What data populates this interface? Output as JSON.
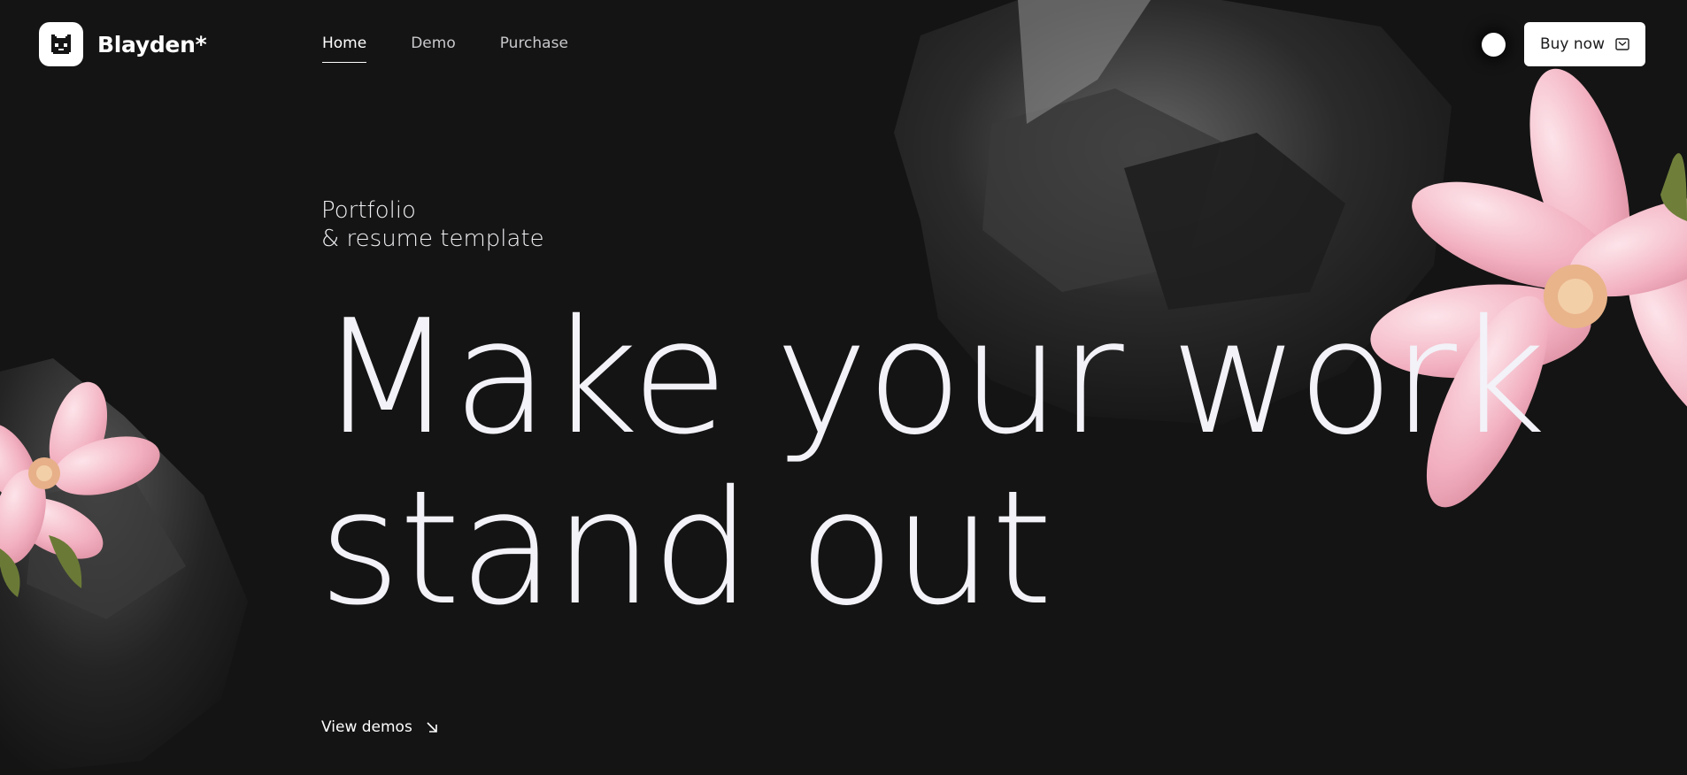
{
  "brand": {
    "name": "Blayden*",
    "logo": "pixel-cat-logo"
  },
  "nav": {
    "items": [
      {
        "label": "Home",
        "active": true
      },
      {
        "label": "Demo",
        "active": false
      },
      {
        "label": "Purchase",
        "active": false
      }
    ]
  },
  "header": {
    "theme_toggle": "theme-toggle-dot",
    "buy_label": "Buy now",
    "buy_icon": "mail-icon"
  },
  "hero": {
    "subtitle_line1": "Portfolio",
    "subtitle_line2": "& resume template",
    "title_line1": "Make your work",
    "title_line2": "stand out",
    "cta_label": "View demos",
    "cta_icon": "arrow-down-right-icon"
  },
  "colors": {
    "background": "#141414",
    "text": "#f4f4f8",
    "button_bg": "#ffffff",
    "flower_pink": "#f2b6c4"
  }
}
